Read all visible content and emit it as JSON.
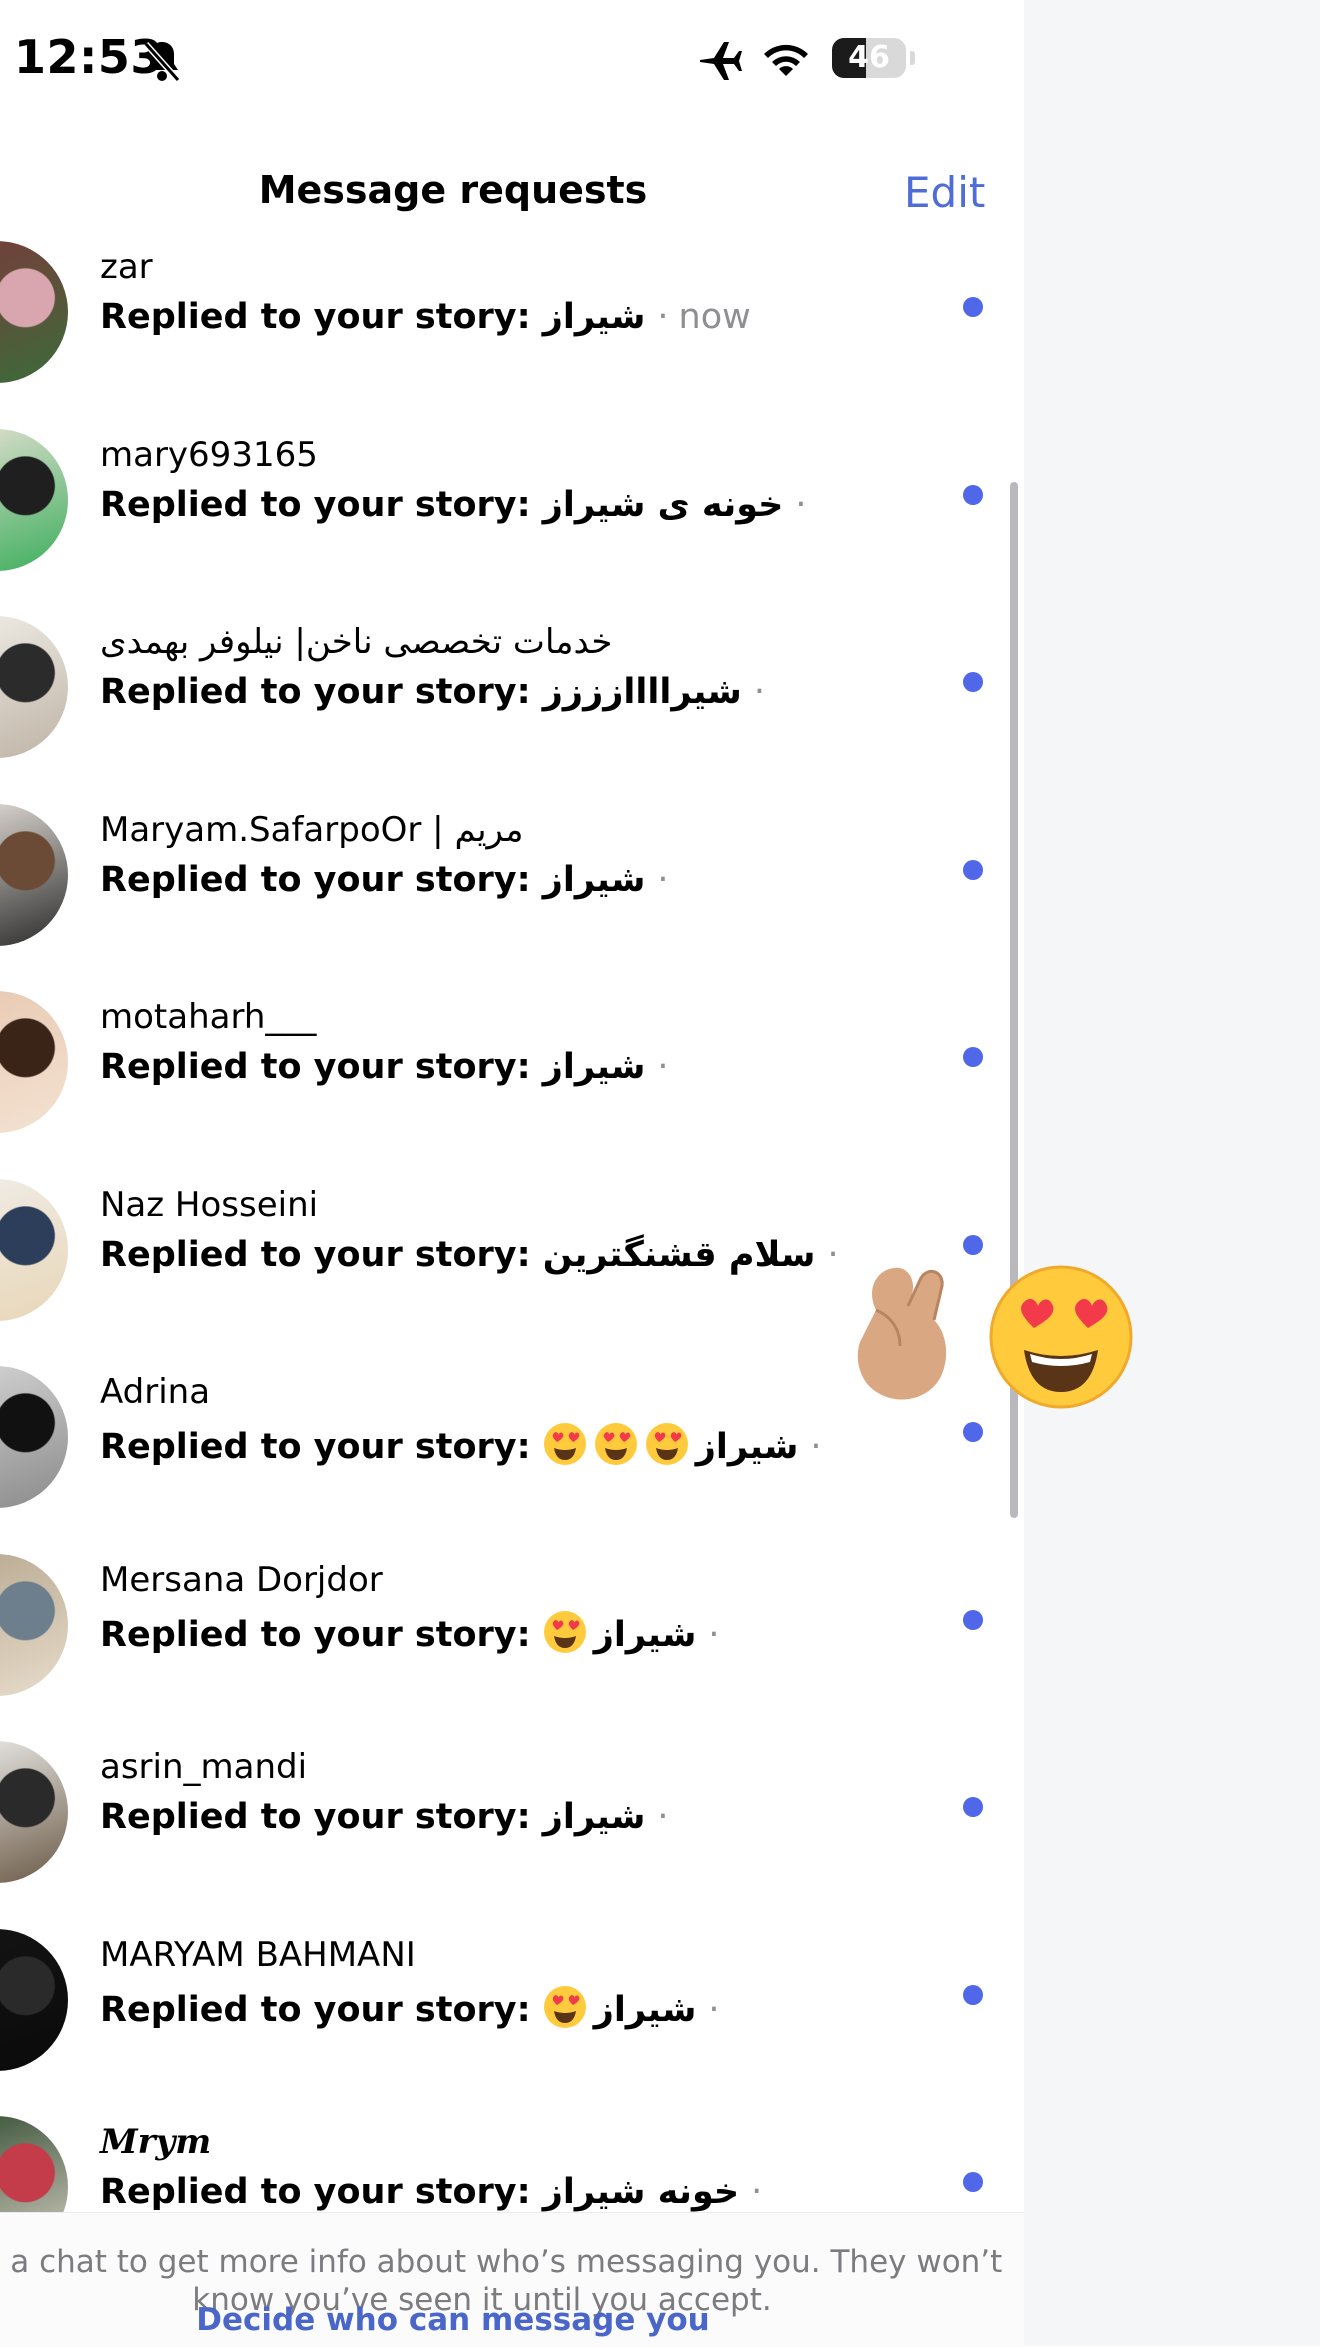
{
  "status_bar": {
    "time": "12:53",
    "battery_level": "46",
    "icons": [
      "bell-slash-icon",
      "airplane-icon",
      "wifi-icon",
      "battery-icon"
    ]
  },
  "header": {
    "title": "Message requests",
    "edit_label": "Edit"
  },
  "requests": [
    {
      "name": "zar",
      "preview_prefix": "Replied to your story: ",
      "preview_text": "شیراز",
      "separator": "·",
      "time": "now",
      "unread": true
    },
    {
      "name": "mary693165",
      "preview_prefix": "Replied to your story: ",
      "preview_text": "خونه ی شیراز",
      "separator": "·",
      "time": "",
      "unread": true
    },
    {
      "name": "خدمات تخصصی ناخن| نیلوفر بهمدی",
      "preview_prefix": "Replied to your story: ",
      "preview_text": "شیراااازززز",
      "separator": "·",
      "time": "",
      "unread": true
    },
    {
      "name": "Maryam.SafarpoOr | مریم",
      "preview_prefix": "Replied to your story: ",
      "preview_text": "شیراز",
      "separator": "·",
      "time": "",
      "unread": true
    },
    {
      "name": "motaharh___",
      "preview_prefix": "Replied to your story: ",
      "preview_text": "شیراز",
      "separator": "·",
      "time": "",
      "unread": true
    },
    {
      "name": "Naz Hosseini",
      "preview_prefix": "Replied to your story: ",
      "preview_text": "سلام قشنگترین",
      "separator": "·",
      "time": "",
      "unread": true
    },
    {
      "name": "Adrina",
      "preview_prefix": "Replied to your story: ",
      "emoji_count": 3,
      "preview_text": "شیراز",
      "separator": "·",
      "time": "",
      "unread": true
    },
    {
      "name": "Mersana Dorjdor",
      "preview_prefix": "Replied to your story: ",
      "emoji_count": 1,
      "preview_text": "شیراز",
      "separator": "·",
      "time": "",
      "unread": true
    },
    {
      "name": "asrin_mandi",
      "preview_prefix": "Replied to your story: ",
      "preview_text": "شیراز",
      "separator": "·",
      "time": "",
      "unread": true
    },
    {
      "name": "MARYAM BAHMANI",
      "preview_prefix": "Replied to your story: ",
      "emoji_count": 1,
      "preview_text": "شیراز",
      "separator": "·",
      "time": "",
      "unread": true
    },
    {
      "name": "Mrym",
      "preview_prefix": "Replied to your story: ",
      "preview_text": "خونه شیراز",
      "separator": "·",
      "time": "",
      "unread": true
    }
  ],
  "reactions": {
    "left_icon": "fingers-snap-icon",
    "right_icon": "heart-eyes-icon"
  },
  "footer": {
    "info": "en a chat to get more info about who’s messaging you. They won’t know you’ve seen it until you accept.",
    "link": "Decide who can message you"
  },
  "colors": {
    "accent": "#4f6cd9",
    "unread_dot": "#4f67e8",
    "muted": "#8e8e93"
  }
}
